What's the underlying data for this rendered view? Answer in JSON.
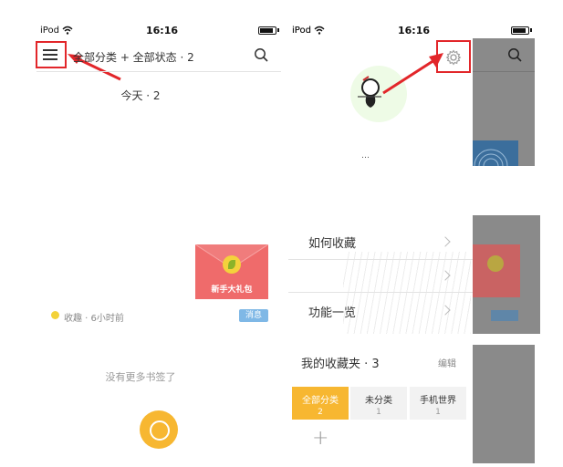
{
  "status_bar": {
    "carrier": "iPod",
    "time": "16:16"
  },
  "feed": {
    "filter_title": "全部分类 + 全部状态 · 2",
    "section_today": "今天 · 2",
    "banner_text": "新手大礼包",
    "item_meta": "收趣 · 6小时前",
    "item_badge": "消息",
    "end_text": "没有更多书签了"
  },
  "drawer": {
    "username_partial": "…",
    "menu_items": [
      {
        "label": "如何收藏"
      },
      {
        "label": ""
      },
      {
        "label": "功能一览"
      }
    ],
    "folders_title": "我的收藏夹 · 3",
    "edit_label": "编辑",
    "folders": [
      {
        "name": "全部分类",
        "count": "2"
      },
      {
        "name": "未分类",
        "count": "1"
      },
      {
        "name": "手机世界",
        "count": "1"
      }
    ],
    "add_symbol": "+"
  },
  "colors": {
    "annotation_red": "#e2262a",
    "accent_yellow": "#f7b731",
    "banner_red": "#ef6b6b",
    "badge_blue": "#7fb8e6",
    "drawer_overlay": "#8a8a8a"
  },
  "icons": [
    "wifi-icon",
    "battery-icon",
    "menu-icon",
    "search-icon",
    "gear-icon",
    "chevron-right-icon",
    "add-icon",
    "chat-icon",
    "arrow-annotation"
  ]
}
